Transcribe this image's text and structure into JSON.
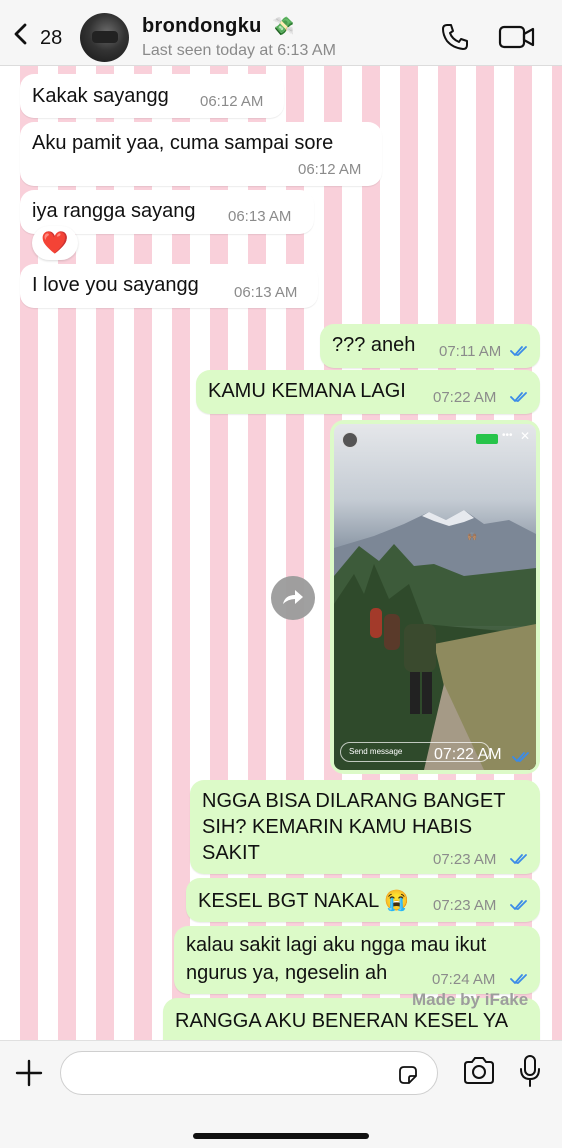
{
  "header": {
    "back_count": "28",
    "contact_name": "brondongku",
    "contact_emoji": "💸",
    "last_seen": "Last seen today at 6:13 AM"
  },
  "messages": [
    {
      "dir": "in",
      "text": "Kakak sayangg",
      "time": "06:12 AM"
    },
    {
      "dir": "in",
      "text": "Aku pamit yaa, cuma sampai sore",
      "time": "06:12 AM"
    },
    {
      "dir": "in",
      "text": "iya rangga sayang",
      "time": "06:13 AM",
      "reaction": "❤️"
    },
    {
      "dir": "in",
      "text": "I love you sayangg",
      "time": "06:13 AM"
    },
    {
      "dir": "out",
      "text": "??? aneh",
      "time": "07:11 AM",
      "status": "read"
    },
    {
      "dir": "out",
      "text": "KAMU KEMANA LAGI",
      "time": "07:22 AM",
      "status": "read"
    },
    {
      "dir": "out",
      "type": "story",
      "time": "07:22 AM",
      "status": "read",
      "reply_placeholder": "Send message"
    },
    {
      "dir": "out",
      "lines": [
        "NGGA BISA DILARANG BANGET",
        "SIH? KEMARIN KAMU HABIS",
        "SAKIT"
      ],
      "time": "07:23 AM",
      "status": "read"
    },
    {
      "dir": "out",
      "text": "KESEL BGT NAKAL 😭",
      "time": "07:23 AM",
      "status": "read"
    },
    {
      "dir": "out",
      "lines": [
        "kalau sakit lagi aku ngga mau ikut",
        "ngurus ya, ngeselin ah"
      ],
      "time": "07:24 AM",
      "status": "read"
    },
    {
      "dir": "out",
      "text": "RANGGA AKU BENERAN KESEL YA"
    }
  ],
  "watermark": "Made by iFake",
  "composer": {
    "placeholder": ""
  },
  "colors": {
    "incoming": "#ffffff",
    "outgoing": "#dcfac8",
    "stripe_pink": "#f9d0da",
    "read_tick": "#3b8be8"
  }
}
